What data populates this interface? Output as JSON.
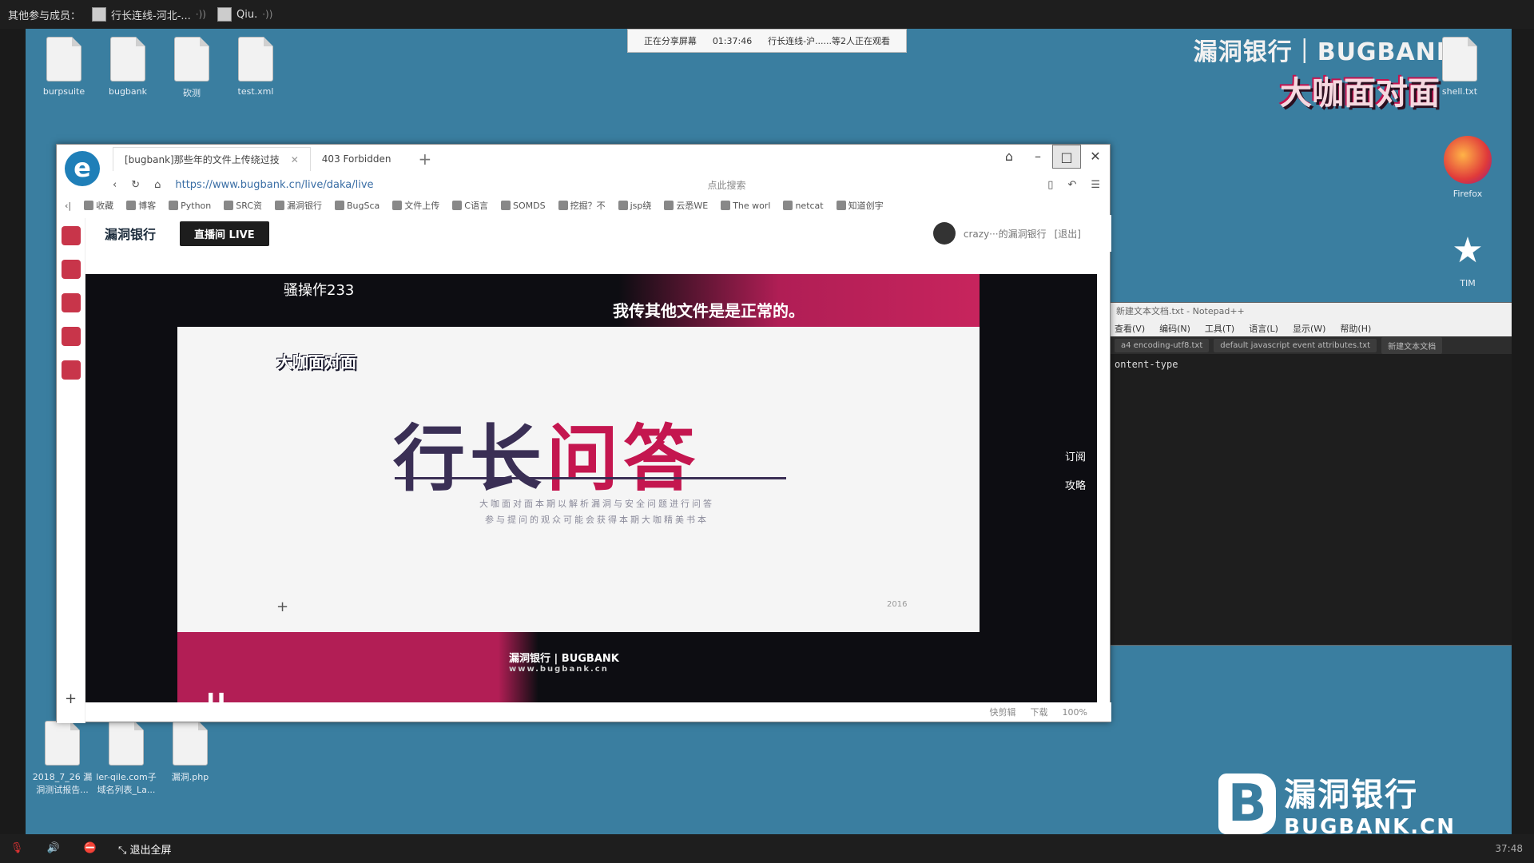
{
  "top_bar": {
    "label": "其他参与成员：",
    "members": [
      "行长连线-河北-...",
      "Qiu."
    ],
    "wave": "·))"
  },
  "share_badge": {
    "status": "正在分享屏幕",
    "timer": "01:37:46",
    "viewers": "行长连线-沪......等2人正在观看"
  },
  "brand": {
    "top_text": "漏洞银行｜BUGBANK",
    "top_logo": "大咖面对面",
    "bottom_cn": "漏洞银行",
    "bottom_en": "BUGBANK.CN",
    "accent": "#c4164f"
  },
  "desktop_icons": [
    {
      "label": "burpsuite"
    },
    {
      "label": "bugbank"
    },
    {
      "label": "砍测"
    },
    {
      "label": "test.xml"
    }
  ],
  "side_apps": [
    {
      "label": "Firefox",
      "icon": "firefox-icon"
    },
    {
      "label": "TIM",
      "icon": "tim-icon"
    },
    {
      "label": "shell.txt",
      "icon": "file-icon"
    }
  ],
  "bottom_icons": [
    {
      "label": "2018_7_26 漏洞测试报告..."
    },
    {
      "label": "ler-qile.com子域名列表_La..."
    },
    {
      "label": "漏洞.php"
    }
  ],
  "notepad": {
    "title": "新建文本文档.txt - Notepad++",
    "menu": [
      "查看(V)",
      "编码(N)",
      "工具(T)",
      "语言(L)",
      "显示(W)",
      "帮助(H)"
    ],
    "tabs": [
      "a4 encoding-utf8.txt",
      "default javascript event attributes.txt",
      "新建文本文档"
    ],
    "content": "ontent-type"
  },
  "browser": {
    "tabs": [
      {
        "label": "[bugbank]那些年的文件上传绕过技",
        "active": true
      },
      {
        "label": "403 Forbidden",
        "active": false
      }
    ],
    "url": "https://www.bugbank.cn/live/daka/live",
    "search_placeholder": "点此搜索",
    "bookmarks": [
      "收藏",
      "博客",
      "Python",
      "SRC资",
      "漏洞银行",
      "BugSca",
      "文件上传",
      "C语言",
      "SOMDS",
      "挖掘？不",
      "jsp绕",
      "云悉WE",
      "The worl",
      "netcat",
      "知道创宇"
    ],
    "site": {
      "logo": "漏洞银行",
      "live_button": "直播间 LIVE",
      "user": "crazy···的漏洞银行",
      "logout": "[退出]"
    },
    "video": {
      "nickname": "骚操作233",
      "danmu": "我传其他文件是是正常的。",
      "slide_logo": "大咖面对面",
      "slide_title_a": "行长",
      "slide_title_b": "问答",
      "slide_sub_1": "大咖面对面本期以解析漏洞与安全问题进行问答",
      "slide_sub_2": "参与提问的观众可能会获得本期大咖精美书本",
      "slide_year": "2016",
      "slide_brand": "漏洞银行 | BUGBANK",
      "slide_brand_url": "www.bugbank.cn",
      "side_subscribe": "订阅",
      "side_guide": "攻略"
    },
    "status_bar": [
      "快剪辑",
      "下载",
      "100%"
    ]
  },
  "taskbar": {
    "exit_fullscreen": "退出全屏",
    "time": "37:48"
  }
}
